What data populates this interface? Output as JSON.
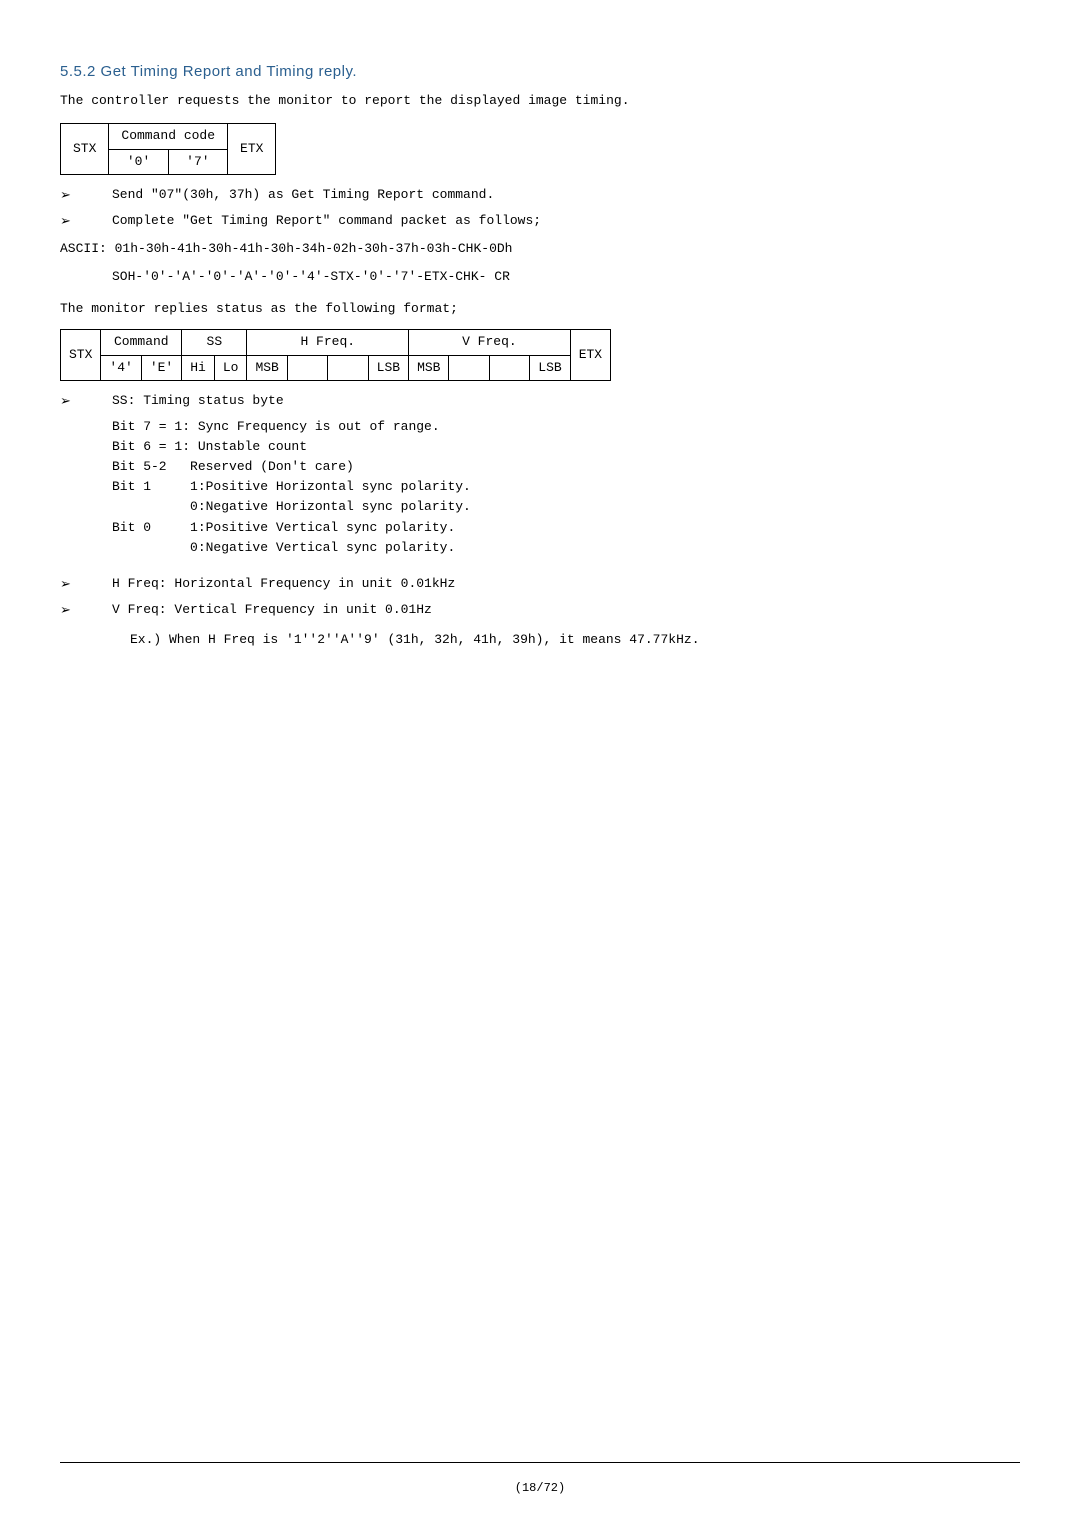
{
  "heading": "5.5.2 Get Timing Report and Timing reply.",
  "intro": "The controller requests the monitor to report the displayed image timing.",
  "table1": {
    "stx": "STX",
    "cmd_header": "Command code",
    "c0": "'0'",
    "c7": "'7'",
    "etx": "ETX"
  },
  "bullet1": "Send \"07\"(30h, 37h) as Get Timing Report command.",
  "bullet2": "Complete \"Get Timing Report\" command packet as follows;",
  "ascii": "ASCII: 01h-30h-41h-30h-41h-30h-34h-02h-30h-37h-03h-CHK-0Dh",
  "soh": "SOH-'0'-'A'-'0'-'A'-'0'-'4'-STX-'0'-'7'-ETX-CHK- CR",
  "reply_sentence": "The monitor replies status as the following format;",
  "table2": {
    "stx": "STX",
    "cmd": "Command",
    "c4": "'4'",
    "cE": "'E'",
    "ss": "SS",
    "hi": "Hi",
    "lo": "Lo",
    "hfreq": "H Freq.",
    "vfreq": "V Freq.",
    "msb": "MSB",
    "lsb": "LSB",
    "etx": "ETX"
  },
  "ss_label": "SS: Timing status byte",
  "bit7": "Bit 7 = 1: Sync Frequency is out of range.",
  "bit6": "Bit 6 = 1: Unstable count",
  "bit52": "Bit 5-2   Reserved (Don't care)",
  "bit1a": "Bit 1     1:Positive Horizontal sync polarity.",
  "bit1b": "          0:Negative Horizontal sync polarity.",
  "bit0a": "Bit 0     1:Positive Vertical sync polarity.",
  "bit0b": "          0:Negative Vertical sync polarity.",
  "hfreq_desc": "H Freq: Horizontal Frequency in unit 0.01kHz",
  "vfreq_desc": "V Freq: Vertical Frequency in unit 0.01Hz",
  "example": "Ex.) When H Freq is '1''2''A''9' (31h, 32h, 41h, 39h), it means 47.77kHz.",
  "page": "(18/72)"
}
